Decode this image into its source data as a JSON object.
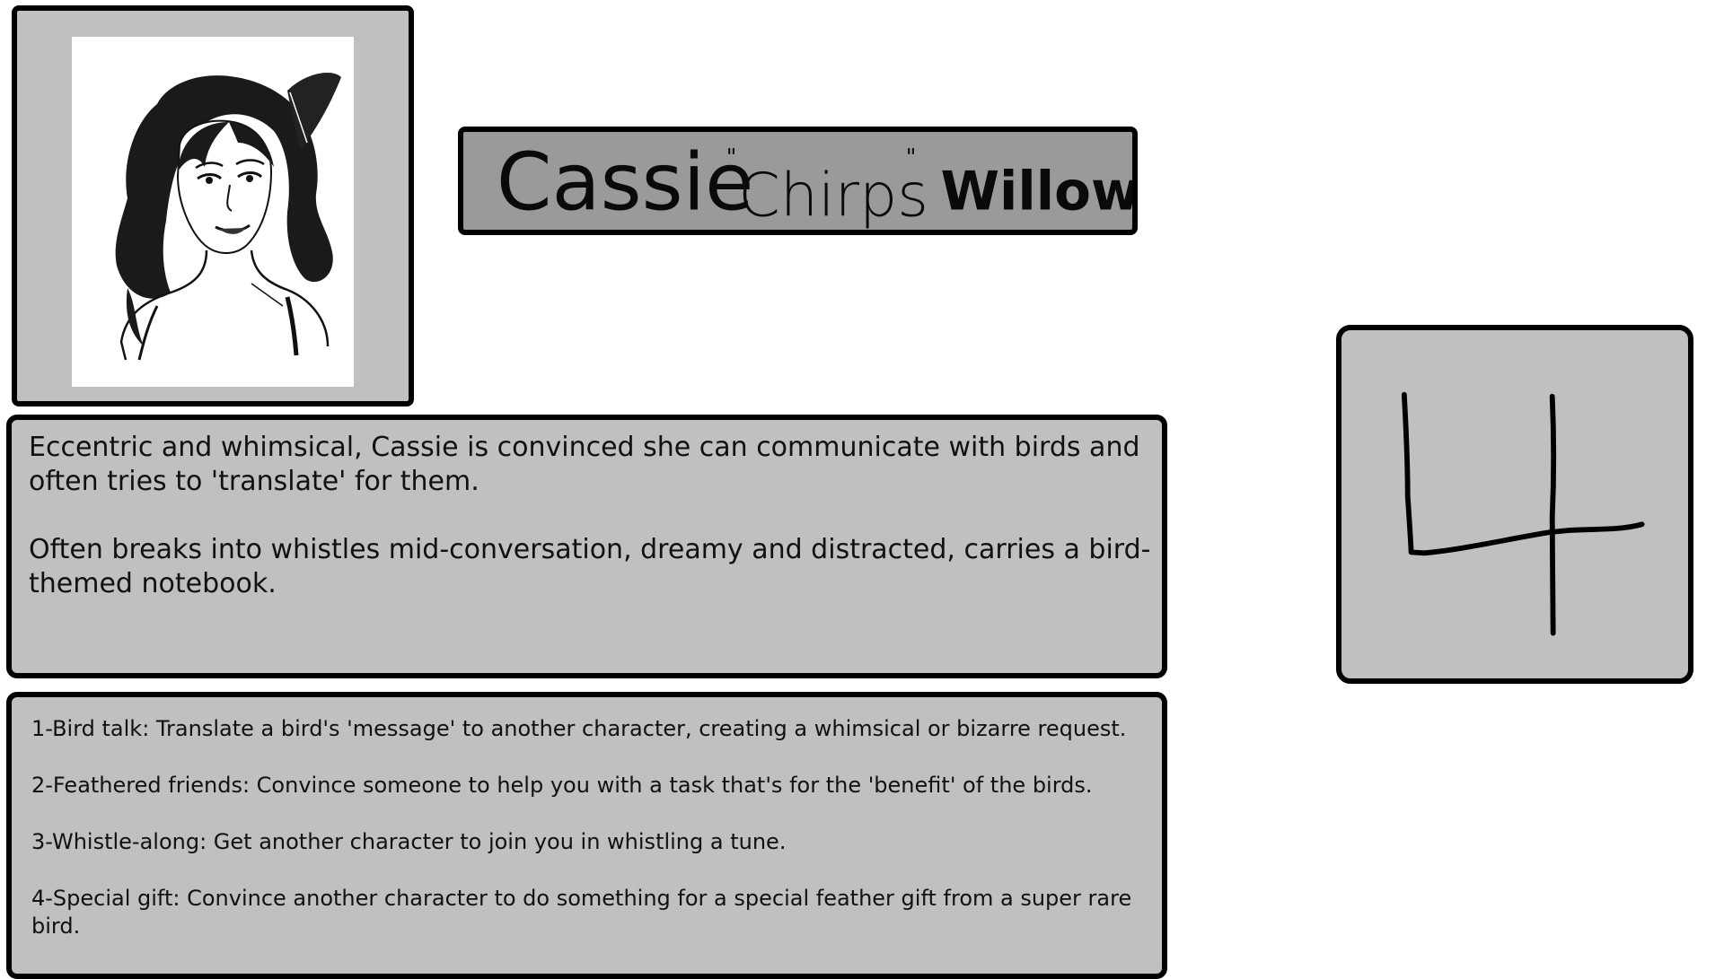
{
  "character": {
    "name_first": "Cassie",
    "name_nick": "Chirps",
    "name_last": "Willow"
  },
  "portrait": {
    "icon": "woman-portrait-ink-illustration"
  },
  "description": {
    "paragraphs": [
      "Eccentric and whimsical, Cassie is convinced she can communicate with birds and often tries to 'translate' for them.",
      "Often breaks into whistles mid-conversation, dreamy and distracted, carries a bird-themed notebook."
    ]
  },
  "abilities": [
    "1-Bird talk: Translate a bird's 'message' to another character, creating a whimsical or bizarre request.",
    "2-Feathered friends: Convince someone to help you with a task that's for the 'benefit' of the birds.",
    "3-Whistle-along: Get another character to join you in whistling a tune.",
    "4-Special gift: Convince another character to do something for a special feather gift from a super rare bird."
  ],
  "number_card": {
    "value": "4"
  },
  "colors": {
    "panel": "#c0c0c0",
    "banner": "#9a9a9a",
    "border": "#000000"
  }
}
